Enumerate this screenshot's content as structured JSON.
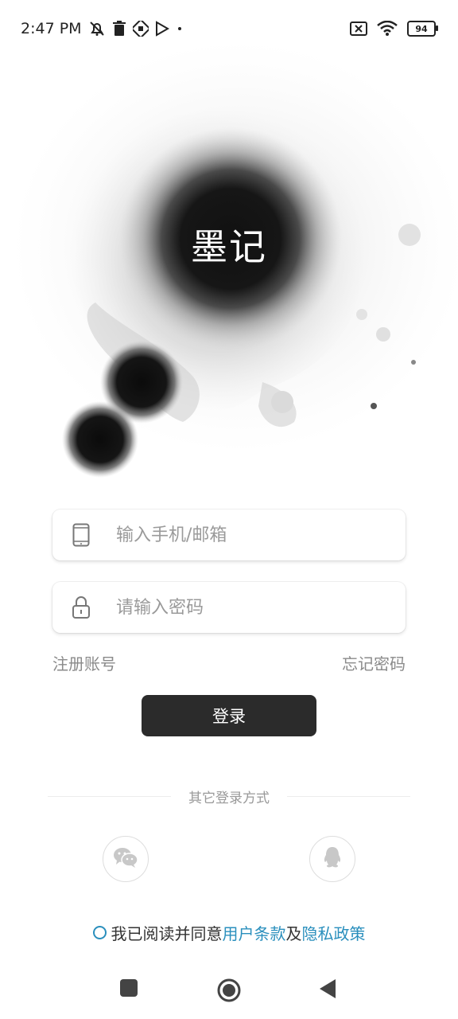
{
  "status_bar": {
    "time": "2:47 PM",
    "battery": "94"
  },
  "hero": {
    "app_title": "墨记"
  },
  "login_form": {
    "phone_placeholder": "输入手机/邮箱",
    "password_placeholder": "请输入密码",
    "register_label": "注册账号",
    "forgot_label": "忘记密码",
    "login_label": "登录"
  },
  "other_login": {
    "label": "其它登录方式",
    "options": [
      "wechat-icon",
      "qq-icon"
    ]
  },
  "agreement": {
    "prefix": "我已阅读并同意",
    "terms_link": "用户条款",
    "connector": "及",
    "privacy_link": "隐私政策",
    "link_color": "#2a8fbd"
  },
  "colors": {
    "primary_button": "#2b2b2b",
    "accent": "#2a8fbd"
  }
}
